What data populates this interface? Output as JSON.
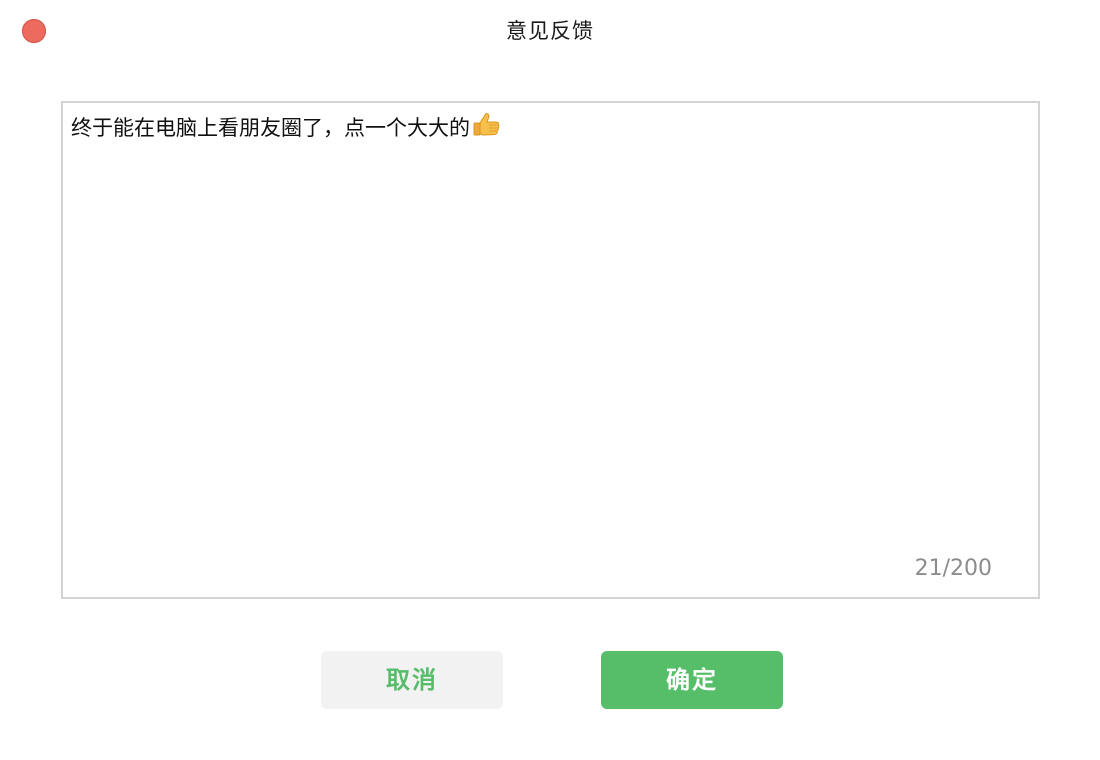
{
  "window": {
    "title": "意见反馈"
  },
  "feedback": {
    "text": "终于能在电脑上看朋友圈了，点一个大大的",
    "emoji_icon": "thumbs-up-icon",
    "counter": "21/200"
  },
  "actions": {
    "cancel_label": "取消",
    "confirm_label": "确定"
  },
  "colors": {
    "close": "#ec6a5e",
    "accent": "#56bd68",
    "cancel_bg": "#f2f2f2"
  }
}
